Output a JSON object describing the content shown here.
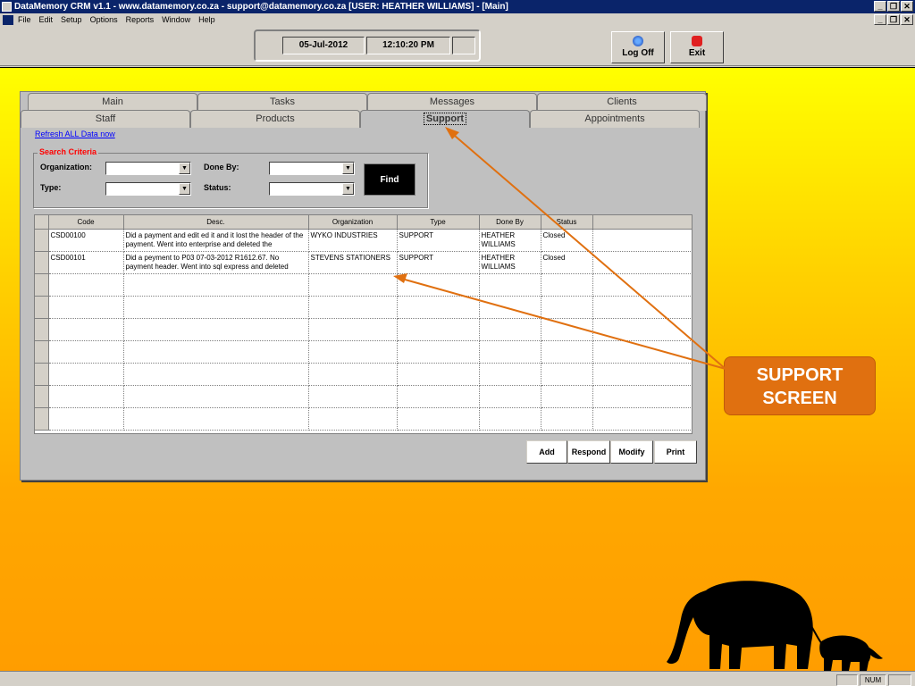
{
  "window": {
    "title": "DataMemory CRM v1.1 - www.datamemory.co.za - support@datamemory.co.za [USER: HEATHER WILLIAMS] - [Main]",
    "controls": [
      "_",
      "❐",
      "✕"
    ]
  },
  "menu": [
    "File",
    "Edit",
    "Setup",
    "Options",
    "Reports",
    "Window",
    "Help"
  ],
  "toolbar": {
    "date": "05-Jul-2012",
    "time": "12:10:20 PM",
    "logoff_label": "Log Off",
    "exit_label": "Exit"
  },
  "tabs": {
    "row1": [
      "Main",
      "Tasks",
      "Messages",
      "Clients"
    ],
    "row2": [
      "Staff",
      "Products",
      "Support",
      "Appointments"
    ],
    "active": "Support"
  },
  "refresh_link": "Refresh ALL Data now",
  "search": {
    "title": "Search Criteria",
    "organization_label": "Organization:",
    "doneby_label": "Done By:",
    "type_label": "Type:",
    "status_label": "Status:",
    "organization_value": "",
    "doneby_value": "",
    "type_value": "",
    "status_value": "",
    "find_label": "Find"
  },
  "grid": {
    "columns": [
      "Code",
      "Desc.",
      "Organization",
      "Type",
      "Done By",
      "Status"
    ],
    "rows": [
      {
        "code": "CSD00100",
        "desc": "Did a payment and edit ed it and it lost the header of the payment. Went into enterprise and deleted the",
        "organization": "WYKO INDUSTRIES",
        "type": "SUPPORT",
        "doneby": "HEATHER WILLIAMS",
        "status": "Closed"
      },
      {
        "code": "CSD00101",
        "desc": "Did a peyment to P03 07-03-2012 R1612.67. No payment header. Went into sql express and deleted",
        "organization": "STEVENS STATIONERS",
        "type": "SUPPORT",
        "doneby": "HEATHER WILLIAMS",
        "status": "Closed"
      }
    ],
    "empty_rows": 7
  },
  "actions": {
    "add": "Add",
    "respond": "Respond",
    "modify": "Modify",
    "print": "Print"
  },
  "callout": {
    "line1": "SUPPORT",
    "line2": "SCREEN"
  },
  "statusbar": {
    "num": "NUM"
  },
  "colors": {
    "titlebar": "#0a246a",
    "callout": "#e07010",
    "arrow": "#e07010",
    "link": "#0000ff",
    "criteria_title": "#ff0000"
  }
}
